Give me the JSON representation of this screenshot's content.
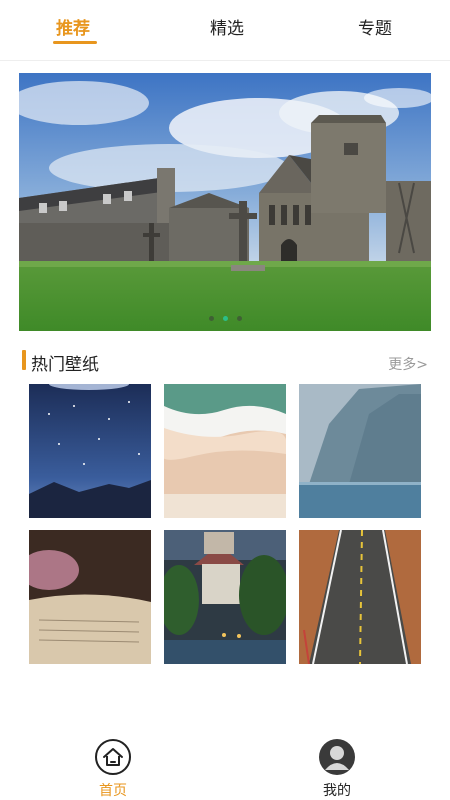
{
  "top_tabs": [
    {
      "label": "推荐",
      "active": true
    },
    {
      "label": "精选",
      "active": false
    },
    {
      "label": "专题",
      "active": false
    }
  ],
  "banner": {
    "image": "stone-abbey-landscape",
    "page_count": 3,
    "active_index": 1
  },
  "section": {
    "title": "热门壁纸",
    "more_label": "更多>"
  },
  "wallpapers": [
    {
      "name": "starry-night-mountains"
    },
    {
      "name": "beach-waves-aerial"
    },
    {
      "name": "misty-sea-cliff"
    },
    {
      "name": "open-book-closeup"
    },
    {
      "name": "castle-by-lake-night"
    },
    {
      "name": "desert-road"
    }
  ],
  "bottom_nav": [
    {
      "label": "首页",
      "icon": "home-icon",
      "active": true
    },
    {
      "label": "我的",
      "icon": "user-avatar-icon",
      "active": false
    }
  ],
  "colors": {
    "accent": "#e8961e",
    "dot_active": "#2bbf88"
  }
}
